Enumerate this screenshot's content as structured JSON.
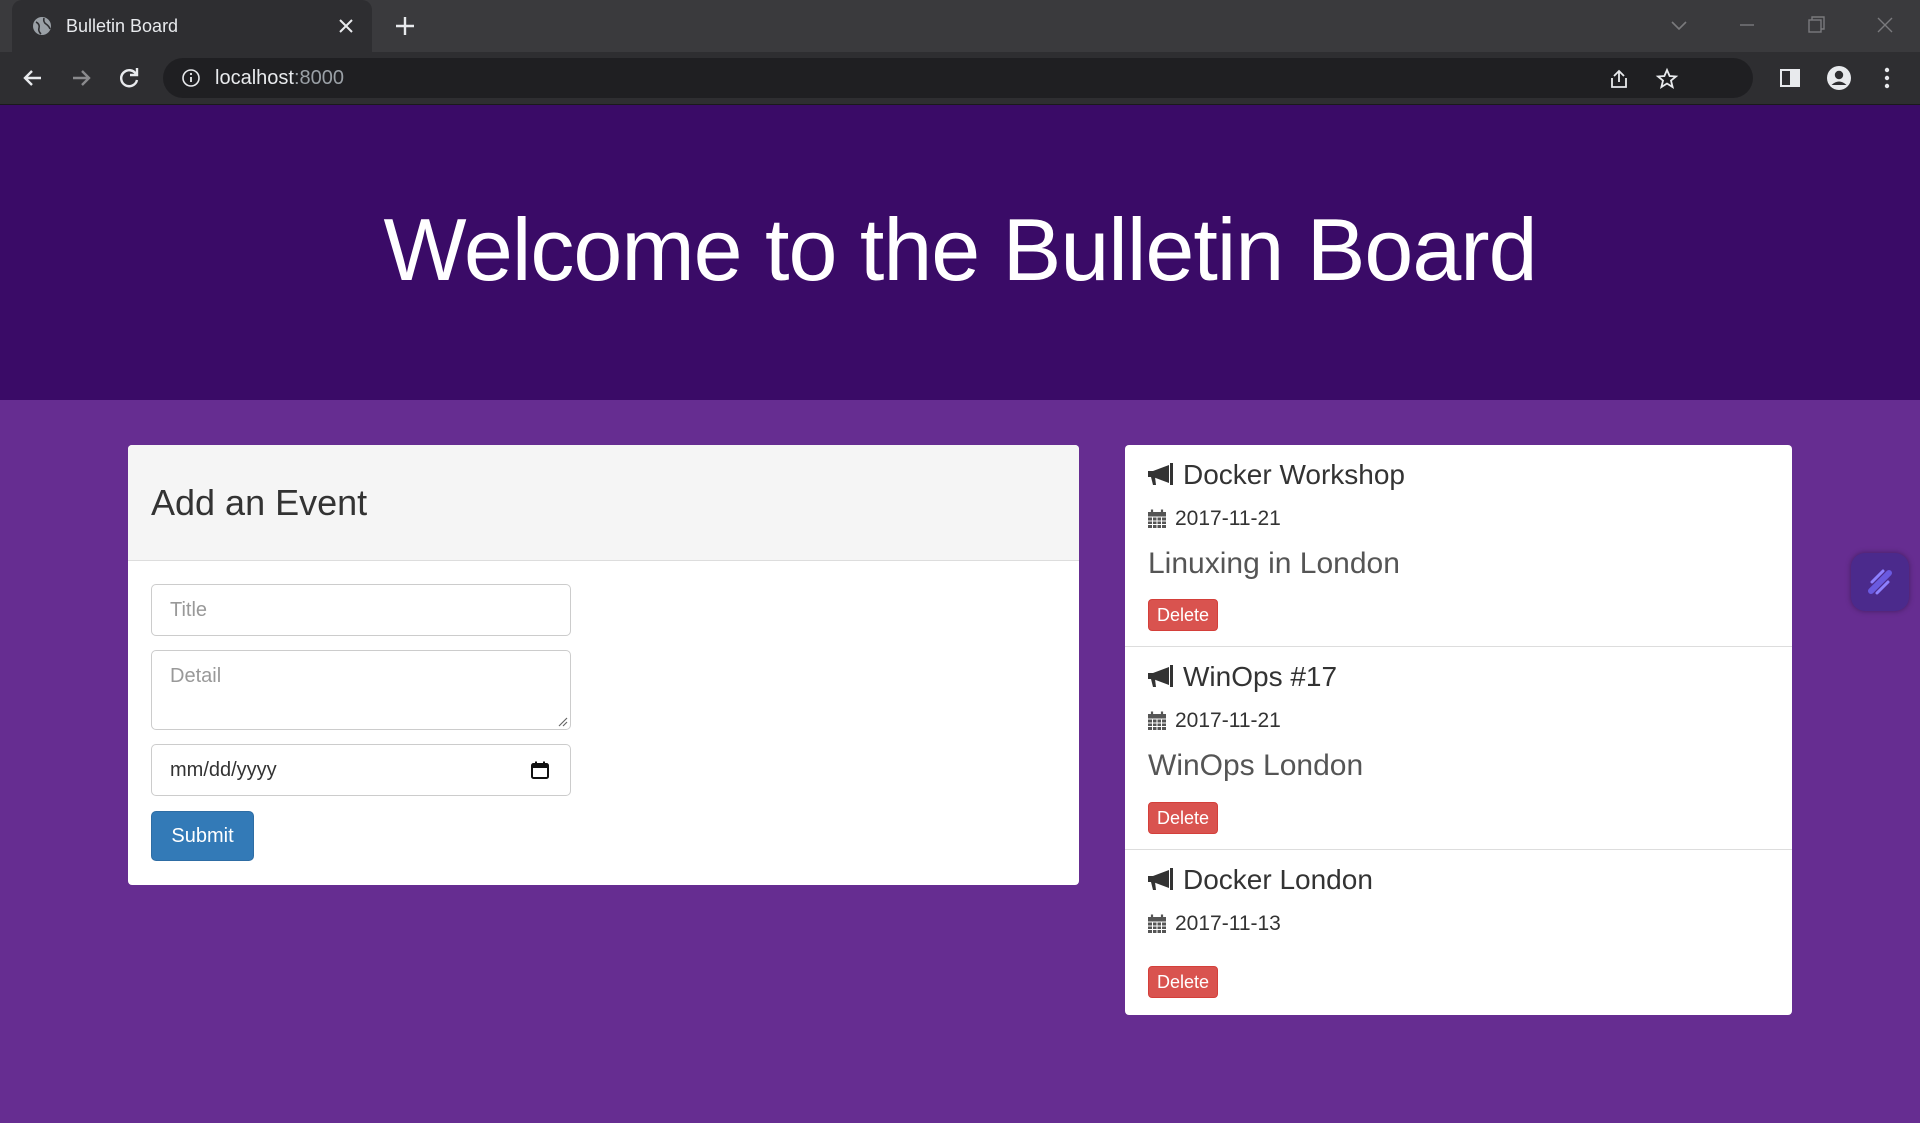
{
  "browser": {
    "tab_title": "Bulletin Board",
    "url_host": "localhost",
    "url_port": ":8000"
  },
  "page": {
    "heading": "Welcome to the Bulletin Board"
  },
  "add_event": {
    "title": "Add an Event",
    "title_placeholder": "Title",
    "detail_placeholder": "Detail",
    "date_placeholder": "mm/dd/yyyy",
    "submit_label": "Submit"
  },
  "events": [
    {
      "title": "Docker Workshop",
      "date": "2017-11-21",
      "detail": "Linuxing in London",
      "delete_label": "Delete"
    },
    {
      "title": "WinOps #17",
      "date": "2017-11-21",
      "detail": "WinOps London",
      "delete_label": "Delete"
    },
    {
      "title": "Docker London",
      "date": "2017-11-13",
      "detail": "",
      "delete_label": "Delete"
    }
  ],
  "colors": {
    "jumbotron": "#3a0b67",
    "page_background": "#662d91",
    "submit": "#337ab7",
    "delete": "#d9534f"
  },
  "icons": [
    "globe-icon",
    "close-icon",
    "plus-icon",
    "back-icon",
    "forward-icon",
    "reload-icon",
    "info-icon",
    "share-icon",
    "star-icon",
    "sidebar-icon",
    "profile-icon",
    "menu-icon",
    "bullhorn-icon",
    "calendar-icon",
    "extension-icon"
  ]
}
